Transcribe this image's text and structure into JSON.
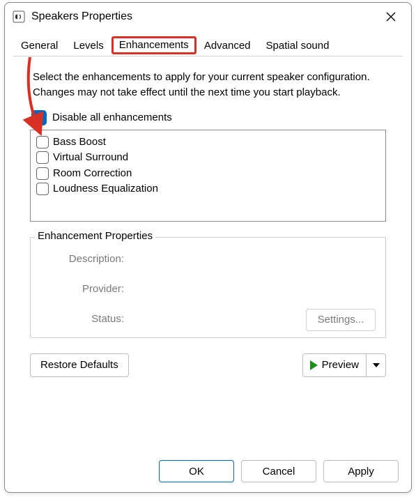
{
  "window": {
    "title": "Speakers Properties"
  },
  "tabs": [
    {
      "label": "General"
    },
    {
      "label": "Levels"
    },
    {
      "label": "Enhancements",
      "highlighted": true
    },
    {
      "label": "Advanced"
    },
    {
      "label": "Spatial sound"
    }
  ],
  "pane": {
    "description": "Select the enhancements to apply for your current speaker configuration. Changes may not take effect until the next time you start playback.",
    "disable_all_label": "Disable all enhancements",
    "disable_all_checked": true,
    "enhancements": [
      {
        "label": "Bass Boost",
        "checked": false
      },
      {
        "label": "Virtual Surround",
        "checked": false
      },
      {
        "label": "Room Correction",
        "checked": false
      },
      {
        "label": "Loudness Equalization",
        "checked": false
      }
    ],
    "properties": {
      "title": "Enhancement Properties",
      "description_label": "Description:",
      "provider_label": "Provider:",
      "status_label": "Status:",
      "settings_label": "Settings..."
    },
    "restore_label": "Restore Defaults",
    "preview_label": "Preview"
  },
  "buttons": {
    "ok": "OK",
    "cancel": "Cancel",
    "apply": "Apply"
  },
  "annotation": {
    "color": "#d93025"
  }
}
